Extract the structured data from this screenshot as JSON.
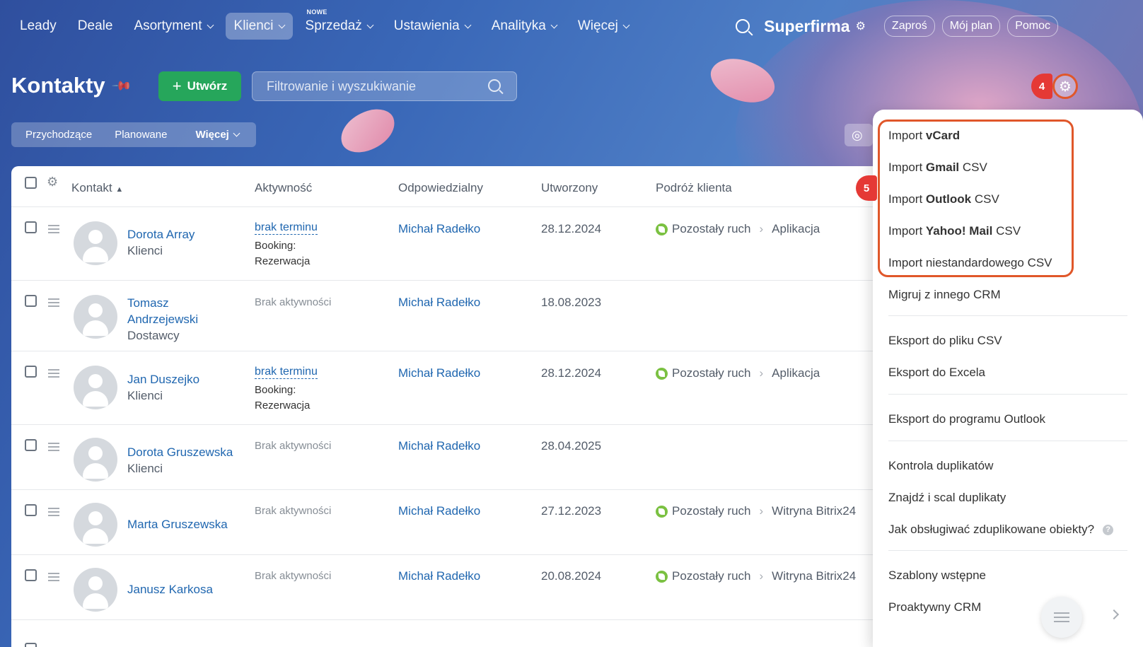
{
  "nav": {
    "items": [
      {
        "label": "Leady"
      },
      {
        "label": "Deale"
      },
      {
        "label": "Asortyment",
        "dropdown": true
      },
      {
        "label": "Klienci",
        "dropdown": true,
        "active": true
      },
      {
        "label": "Sprzedaż",
        "dropdown": true,
        "badge": "NOWE"
      },
      {
        "label": "Ustawienia",
        "dropdown": true
      },
      {
        "label": "Analityka",
        "dropdown": true
      },
      {
        "label": "Więcej",
        "dropdown": true
      }
    ],
    "brand": "Superfirma",
    "buttons": {
      "invite": "Zaproś",
      "plan": "Mój plan",
      "help": "Pomoc"
    }
  },
  "page": {
    "title": "Kontakty",
    "create_label": "Utwórz",
    "search_placeholder": "Filtrowanie i wyszukiwanie",
    "step_badge_gear": "4",
    "step_badge_menu": "5"
  },
  "filters": {
    "incoming": "Przychodzące",
    "planned": "Planowane",
    "more": "Więcej"
  },
  "table": {
    "headers": {
      "contact": "Kontakt",
      "activity": "Aktywność",
      "responsible": "Odpowiedzialny",
      "created": "Utworzony",
      "journey": "Podróż klienta"
    },
    "rows": [
      {
        "name": "Dorota Array",
        "category": "Klienci",
        "activity_link": "brak terminu",
        "activity_text": "Booking: Rezerwacja",
        "responsible": "Michał Radełko",
        "created": "28.12.2024",
        "journey_stage": "Pozostały ruch",
        "journey_source": "Aplikacja"
      },
      {
        "name": "Tomasz Andrzejewski",
        "category": "Dostawcy",
        "activity_none": "Brak aktywności",
        "responsible": "Michał Radełko",
        "created": "18.08.2023"
      },
      {
        "name": "Jan Duszejko",
        "category": "Klienci",
        "activity_link": "brak terminu",
        "activity_text": "Booking: Rezerwacja",
        "responsible": "Michał Radełko",
        "created": "28.12.2024",
        "journey_stage": "Pozostały ruch",
        "journey_source": "Aplikacja"
      },
      {
        "name": "Dorota Gruszewska",
        "category": "Klienci",
        "activity_none": "Brak aktywności",
        "responsible": "Michał Radełko",
        "created": "28.04.2025"
      },
      {
        "name": "Marta Gruszewska",
        "activity_none": "Brak aktywności",
        "responsible": "Michał Radełko",
        "created": "27.12.2023",
        "journey_stage": "Pozostały ruch",
        "journey_source": "Witryna Bitrix24"
      },
      {
        "name": "Janusz Karkosa",
        "activity_none": "Brak aktywności",
        "responsible": "Michał Radełko",
        "created": "20.08.2024",
        "journey_stage": "Pozostały ruch",
        "journey_source": "Witryna Bitrix24"
      }
    ]
  },
  "menu": {
    "import_vcard": {
      "prefix": "Import ",
      "strong": "vCard",
      "suffix": ""
    },
    "import_gmail": {
      "prefix": "Import ",
      "strong": "Gmail",
      "suffix": " CSV"
    },
    "import_outlook": {
      "prefix": "Import ",
      "strong": "Outlook",
      "suffix": " CSV"
    },
    "import_yahoo": {
      "prefix": "Import ",
      "strong": "Yahoo! Mail",
      "suffix": " CSV"
    },
    "import_custom": "Import niestandardowego CSV",
    "migrate": "Migruj z innego CRM",
    "export_csv": "Eksport do pliku CSV",
    "export_excel": "Eksport do Excela",
    "export_outlook": "Eksport do programu Outlook",
    "dup_control": "Kontrola duplikatów",
    "dup_merge": "Znajdź i scal duplikaty",
    "dup_howto": "Jak obsługiwać zduplikowane obiekty?",
    "templates": "Szablony wstępne",
    "proactive": "Proaktywny CRM"
  },
  "colors": {
    "accent_green": "#26a65b",
    "link_blue": "#2067b0",
    "highlight": "#e0572a",
    "badge_red": "#e53935"
  }
}
